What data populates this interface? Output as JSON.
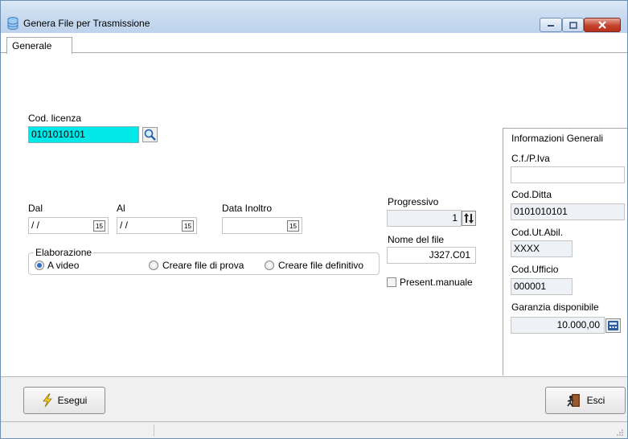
{
  "window": {
    "title": "Genera File per Trasmissione",
    "buttons": {
      "minimize_icon": "minimize-icon",
      "maximize_icon": "maximize-icon",
      "close_icon": "close-icon"
    }
  },
  "tabs": [
    {
      "label": "Generale",
      "active": true
    }
  ],
  "license": {
    "label": "Cod. licenza",
    "value": "0101010101",
    "search_icon": "search-icon"
  },
  "dates": {
    "dal": {
      "label": "Dal",
      "value": "/ /"
    },
    "al": {
      "label": "Al",
      "value": "/ /"
    },
    "data_inoltro": {
      "label": "Data Inoltro",
      "value": ""
    },
    "calendar_icon_text": "15"
  },
  "elaborazione": {
    "title": "Elaborazione",
    "options": [
      {
        "label": "A video",
        "selected": true
      },
      {
        "label": "Creare file di prova",
        "selected": false
      },
      {
        "label": "Creare file definitivo",
        "selected": false
      }
    ]
  },
  "progressivo": {
    "label": "Progressivo",
    "value": "1"
  },
  "nome_file": {
    "label": "Nome del file",
    "value": "J327.C01"
  },
  "present_manuale": {
    "label": "Present.manuale",
    "checked": false
  },
  "info": {
    "title": "Informazioni Generali",
    "cf_piva": {
      "label": "C.f./P.Iva",
      "value": ""
    },
    "cod_ditta": {
      "label": "Cod.Ditta",
      "value": "0101010101"
    },
    "cod_ut_abil": {
      "label": "Cod.Ut.Abil.",
      "value": "XXXX"
    },
    "cod_ufficio": {
      "label": "Cod.Ufficio",
      "value": "000001"
    },
    "garanzia": {
      "label": "Garanzia disponibile",
      "value": "10.000,00"
    }
  },
  "footer": {
    "esegui_label": "Esegui",
    "esci_label": "Esci"
  },
  "colors": {
    "license_bg": "#00e8e8",
    "titlebar": "#c6d9ef",
    "close_red": "#c4422d"
  }
}
